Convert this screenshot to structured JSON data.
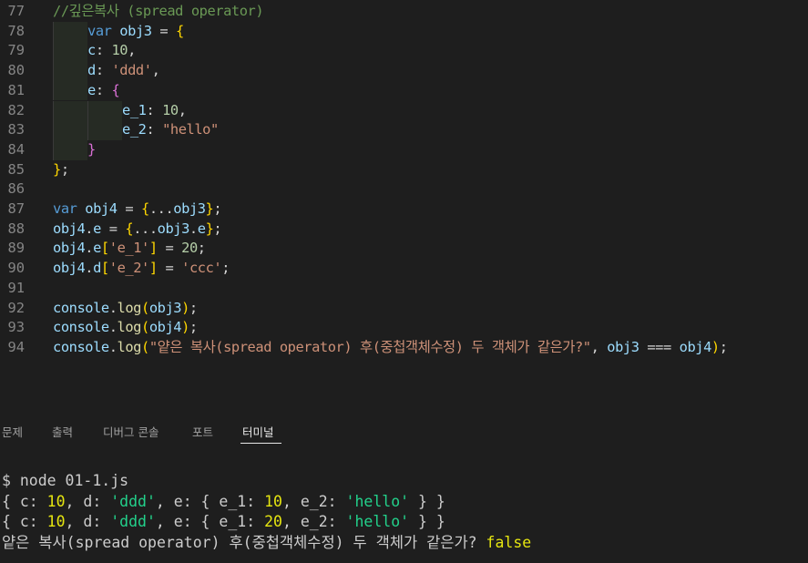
{
  "editor": {
    "lines": [
      {
        "n": "77",
        "tokens": [
          [
            "com",
            "//깊은복사 (spread operator)"
          ]
        ]
      },
      {
        "n": "78",
        "tokens": [
          [
            "kw",
            "var"
          ],
          [
            "pun",
            " "
          ],
          [
            "var",
            "obj3"
          ],
          [
            "pun",
            " = "
          ],
          [
            "br1",
            "{"
          ]
        ]
      },
      {
        "n": "79",
        "tokens": [
          [
            "var",
            "c"
          ],
          [
            "pun",
            ": "
          ],
          [
            "num",
            "10"
          ],
          [
            "pun",
            ","
          ]
        ]
      },
      {
        "n": "80",
        "tokens": [
          [
            "var",
            "d"
          ],
          [
            "pun",
            ": "
          ],
          [
            "str",
            "'ddd'"
          ],
          [
            "pun",
            ","
          ]
        ]
      },
      {
        "n": "81",
        "tokens": [
          [
            "var",
            "e"
          ],
          [
            "pun",
            ": "
          ],
          [
            "br2",
            "{"
          ]
        ]
      },
      {
        "n": "82",
        "tokens": [
          [
            "var",
            "e_1"
          ],
          [
            "pun",
            ": "
          ],
          [
            "num",
            "10"
          ],
          [
            "pun",
            ","
          ]
        ]
      },
      {
        "n": "83",
        "tokens": [
          [
            "var",
            "e_2"
          ],
          [
            "pun",
            ": "
          ],
          [
            "str",
            "\"hello\""
          ]
        ]
      },
      {
        "n": "84",
        "tokens": [
          [
            "br2",
            "}"
          ]
        ]
      },
      {
        "n": "85",
        "tokens": [
          [
            "br1",
            "}"
          ],
          [
            "pun",
            ";"
          ]
        ]
      },
      {
        "n": "86",
        "tokens": []
      },
      {
        "n": "87",
        "tokens": [
          [
            "kw",
            "var"
          ],
          [
            "pun",
            " "
          ],
          [
            "var",
            "obj4"
          ],
          [
            "pun",
            " = "
          ],
          [
            "br1",
            "{"
          ],
          [
            "pun",
            "..."
          ],
          [
            "var",
            "obj3"
          ],
          [
            "br1",
            "}"
          ],
          [
            "pun",
            ";"
          ]
        ]
      },
      {
        "n": "88",
        "tokens": [
          [
            "var",
            "obj4"
          ],
          [
            "pun",
            "."
          ],
          [
            "var",
            "e"
          ],
          [
            "pun",
            " = "
          ],
          [
            "br1",
            "{"
          ],
          [
            "pun",
            "..."
          ],
          [
            "var",
            "obj3"
          ],
          [
            "pun",
            "."
          ],
          [
            "var",
            "e"
          ],
          [
            "br1",
            "}"
          ],
          [
            "pun",
            ";"
          ]
        ]
      },
      {
        "n": "89",
        "tokens": [
          [
            "var",
            "obj4"
          ],
          [
            "pun",
            "."
          ],
          [
            "var",
            "e"
          ],
          [
            "br1",
            "["
          ],
          [
            "str",
            "'e_1'"
          ],
          [
            "br1",
            "]"
          ],
          [
            "pun",
            " = "
          ],
          [
            "num",
            "20"
          ],
          [
            "pun",
            ";"
          ]
        ]
      },
      {
        "n": "90",
        "tokens": [
          [
            "var",
            "obj4"
          ],
          [
            "pun",
            "."
          ],
          [
            "var",
            "d"
          ],
          [
            "br1",
            "["
          ],
          [
            "str",
            "'e_2'"
          ],
          [
            "br1",
            "]"
          ],
          [
            "pun",
            " = "
          ],
          [
            "str",
            "'ccc'"
          ],
          [
            "pun",
            ";"
          ]
        ]
      },
      {
        "n": "91",
        "tokens": []
      },
      {
        "n": "92",
        "tokens": [
          [
            "var",
            "console"
          ],
          [
            "pun",
            "."
          ],
          [
            "fn",
            "log"
          ],
          [
            "br1",
            "("
          ],
          [
            "var",
            "obj3"
          ],
          [
            "br1",
            ")"
          ],
          [
            "pun",
            ";"
          ]
        ]
      },
      {
        "n": "93",
        "tokens": [
          [
            "var",
            "console"
          ],
          [
            "pun",
            "."
          ],
          [
            "fn",
            "log"
          ],
          [
            "br1",
            "("
          ],
          [
            "var",
            "obj4"
          ],
          [
            "br1",
            ")"
          ],
          [
            "pun",
            ";"
          ]
        ]
      },
      {
        "n": "94",
        "tokens": [
          [
            "var",
            "console"
          ],
          [
            "pun",
            "."
          ],
          [
            "fn",
            "log"
          ],
          [
            "br1",
            "("
          ],
          [
            "str",
            "\"얕은 복사(spread operator) 후(중첩객체수정) 두 객체가 같은가?\""
          ],
          [
            "pun",
            ", "
          ],
          [
            "var",
            "obj3"
          ],
          [
            "pun",
            " === "
          ],
          [
            "var",
            "obj4"
          ],
          [
            "br1",
            ")"
          ],
          [
            "pun",
            ";"
          ]
        ]
      }
    ]
  },
  "panel": {
    "tabs": [
      {
        "label": "문제",
        "active": false
      },
      {
        "label": "출력",
        "active": false
      },
      {
        "label": "디버그 콘솔",
        "active": false
      },
      {
        "label": "포트",
        "active": false
      },
      {
        "label": "터미널",
        "active": true
      }
    ]
  },
  "terminal": {
    "lines": [
      [
        [
          "p",
          "$ node 01-1.js"
        ]
      ],
      [
        [
          "p",
          "{ c: "
        ],
        [
          "n",
          "10"
        ],
        [
          "p",
          ", d: "
        ],
        [
          "s",
          "'ddd'"
        ],
        [
          "p",
          ", e: { e_1: "
        ],
        [
          "n",
          "10"
        ],
        [
          "p",
          ", e_2: "
        ],
        [
          "s",
          "'hello'"
        ],
        [
          "p",
          " } }"
        ]
      ],
      [
        [
          "p",
          "{ c: "
        ],
        [
          "n",
          "10"
        ],
        [
          "p",
          ", d: "
        ],
        [
          "s",
          "'ddd'"
        ],
        [
          "p",
          ", e: { e_1: "
        ],
        [
          "n",
          "20"
        ],
        [
          "p",
          ", e_2: "
        ],
        [
          "s",
          "'hello'"
        ],
        [
          "p",
          " } }"
        ]
      ],
      [
        [
          "p",
          "얕은 복사(spread operator) 후(중첩객체수정) 두 객체가 같은가? "
        ],
        [
          "b",
          "false"
        ]
      ]
    ]
  },
  "colors": {
    "editor_bg": "#1e1e1e",
    "keyword": "#569cd6",
    "variable": "#9cdcfe",
    "number": "#b5cea8",
    "string": "#ce9178",
    "comment": "#6a9955",
    "function": "#dcdcaa",
    "bracket_level1": "#ffd700",
    "bracket_level2": "#da70d6",
    "terminal_number": "#e5e510",
    "terminal_string": "#23d18b"
  }
}
